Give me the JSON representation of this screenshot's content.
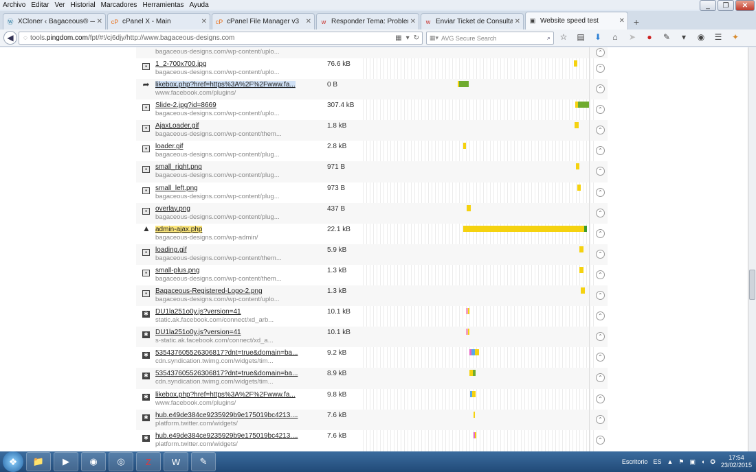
{
  "menu": [
    "Archivo",
    "Editar",
    "Ver",
    "Historial",
    "Marcadores",
    "Herramientas",
    "Ayuda"
  ],
  "tabs": [
    {
      "title": "XCloner ‹ Bagaceous® — Wor...",
      "icon": "wordpress-icon",
      "active": false
    },
    {
      "title": "cPanel X - Main",
      "icon": "cpanel-icon",
      "active": false
    },
    {
      "title": "cPanel File Manager v3",
      "icon": "cpanel-icon",
      "active": false
    },
    {
      "title": "Responder Tema: Problem...",
      "icon": "w-icon",
      "active": false
    },
    {
      "title": "Enviar Ticket de Consulta - ...",
      "icon": "w-icon",
      "active": false
    },
    {
      "title": "Website speed test",
      "icon": "pingdom-icon",
      "active": true
    }
  ],
  "url": {
    "prefix": "tools.",
    "domain": "pingdom.com",
    "rest": "/fpt/#!/cj6djy/http://www.bagaceous-designs.com"
  },
  "search_placeholder": "AVG Secure Search",
  "rows": [
    {
      "name": "",
      "path": "bagaceous-designs.com/wp-content/uplo...",
      "size": "",
      "icon": "image",
      "bars": []
    },
    {
      "name": "1_2-700x700.jpg",
      "path": "bagaceous-designs.com/wp-content/uplo...",
      "size": "76.6 kB",
      "icon": "image",
      "bars": [
        {
          "start": 0.908,
          "width": 0.017,
          "color": "#f5d20f"
        }
      ]
    },
    {
      "name": "likebox.php?href=https%3A%2F%2Fwww.fa...",
      "path": "www.facebook.com/plugins/",
      "size": "0 B",
      "icon": "redirect",
      "hl": "blue",
      "bars": [
        {
          "start": 0.415,
          "width": 0.006,
          "color": "#f5d20f"
        },
        {
          "start": 0.421,
          "width": 0.04,
          "color": "#6fab2f"
        }
      ]
    },
    {
      "name": "Slide-2.jpg?id=8669",
      "path": "bagaceous-designs.com/wp-content/uplo...",
      "size": "307.4 kB",
      "icon": "image",
      "bars": [
        {
          "start": 0.914,
          "width": 0.014,
          "color": "#f5d20f"
        },
        {
          "start": 0.928,
          "width": 0.047,
          "color": "#6fab2f"
        }
      ]
    },
    {
      "name": "AjaxLoader.gif",
      "path": "bagaceous-designs.com/wp-content/them...",
      "size": "1.8 kB",
      "icon": "image",
      "bars": [
        {
          "start": 0.913,
          "width": 0.017,
          "color": "#f5d20f"
        }
      ]
    },
    {
      "name": "loader.gif",
      "path": "bagaceous-designs.com/wp-content/plug...",
      "size": "2.8 kB",
      "icon": "image",
      "bars": [
        {
          "start": 0.438,
          "width": 0.012,
          "color": "#f5d20f"
        }
      ]
    },
    {
      "name": "small_right.png",
      "path": "bagaceous-designs.com/wp-content/plug...",
      "size": "971 B",
      "icon": "image",
      "bars": [
        {
          "start": 0.918,
          "width": 0.014,
          "color": "#f5d20f"
        }
      ]
    },
    {
      "name": "small_left.png",
      "path": "bagaceous-designs.com/wp-content/plug...",
      "size": "973 B",
      "icon": "image",
      "bars": [
        {
          "start": 0.924,
          "width": 0.015,
          "color": "#f5d20f"
        }
      ]
    },
    {
      "name": "overlay.png",
      "path": "bagaceous-designs.com/wp-content/plug...",
      "size": "437 B",
      "icon": "image",
      "bars": [
        {
          "start": 0.453,
          "width": 0.017,
          "color": "#f5d20f"
        }
      ]
    },
    {
      "name": "admin-ajax.php",
      "path": "bagaceous-designs.com/wp-admin/",
      "size": "22.1 kB",
      "icon": "warning",
      "hl": "yellow",
      "bars": [
        {
          "start": 0.44,
          "width": 0.512,
          "color": "#f5d20f"
        },
        {
          "start": 0.952,
          "width": 0.012,
          "color": "#3c9b2e"
        }
      ]
    },
    {
      "name": "loading.gif",
      "path": "bagaceous-designs.com/wp-content/them...",
      "size": "5.9 kB",
      "icon": "image",
      "bars": [
        {
          "start": 0.934,
          "width": 0.017,
          "color": "#f5d20f"
        }
      ]
    },
    {
      "name": "small-plus.png",
      "path": "bagaceous-designs.com/wp-content/them...",
      "size": "1.3 kB",
      "icon": "image",
      "bars": [
        {
          "start": 0.934,
          "width": 0.016,
          "color": "#f5d20f"
        }
      ]
    },
    {
      "name": "Bagaceous-Registered-Logo-2.png",
      "path": "bagaceous-designs.com/wp-content/uplo...",
      "size": "1.3 kB",
      "icon": "image",
      "bars": [
        {
          "start": 0.94,
          "width": 0.016,
          "color": "#f5d20f"
        }
      ]
    },
    {
      "name": "DU1la251o0y.js?version=41",
      "path": "static.ak.facebook.com/connect/xd_arb...",
      "size": "10.1 kB",
      "icon": "script",
      "bars": [
        {
          "start": 0.45,
          "width": 0.008,
          "color": "#f5a0c0"
        },
        {
          "start": 0.458,
          "width": 0.006,
          "color": "#f5d20f"
        }
      ]
    },
    {
      "name": "DU1la251o0y.js?version=41",
      "path": "s-static.ak.facebook.com/connect/xd_a...",
      "size": "10.1 kB",
      "icon": "script",
      "bars": [
        {
          "start": 0.45,
          "width": 0.008,
          "color": "#f5a0c0"
        },
        {
          "start": 0.458,
          "width": 0.006,
          "color": "#f5d20f"
        }
      ]
    },
    {
      "name": "535437605526306817?dnt=true&domain=ba...",
      "path": "cdn.syndication.twimg.com/widgets/tim...",
      "size": "9.2 kB",
      "icon": "script",
      "bars": [
        {
          "start": 0.465,
          "width": 0.008,
          "color": "#e864c8"
        },
        {
          "start": 0.473,
          "width": 0.014,
          "color": "#5aa9e6"
        },
        {
          "start": 0.487,
          "width": 0.018,
          "color": "#f5d20f"
        }
      ]
    },
    {
      "name": "535437605526306817?dnt=true&domain=ba...",
      "path": "cdn.syndication.twimg.com/widgets/tim...",
      "size": "8.9 kB",
      "icon": "script",
      "bars": [
        {
          "start": 0.465,
          "width": 0.015,
          "color": "#f5d20f"
        },
        {
          "start": 0.48,
          "width": 0.01,
          "color": "#6fab2f"
        }
      ]
    },
    {
      "name": "likebox.php?href=https%3A%2F%2Fwww.fa...",
      "path": "www.facebook.com/plugins/",
      "size": "9.8 kB",
      "icon": "script",
      "bars": [
        {
          "start": 0.468,
          "width": 0.01,
          "color": "#5aa9e6"
        },
        {
          "start": 0.478,
          "width": 0.014,
          "color": "#f5d20f"
        }
      ]
    },
    {
      "name": "hub.e49de384ce9235929b9e175019bc4213....",
      "path": "platform.twitter.com/widgets/",
      "size": "7.6 kB",
      "icon": "script",
      "bars": [
        {
          "start": 0.482,
          "width": 0.006,
          "color": "#f5d20f"
        }
      ]
    },
    {
      "name": "hub.e49de384ce9235929b9e175019bc4213....",
      "path": "platform.twitter.com/widgets/",
      "size": "7.6 kB",
      "icon": "script",
      "bars": [
        {
          "start": 0.482,
          "width": 0.005,
          "color": "#e864c8"
        },
        {
          "start": 0.487,
          "width": 0.006,
          "color": "#f5d20f"
        }
      ]
    }
  ],
  "taskbar": {
    "desktop_label": "Escritorio",
    "lang": "ES",
    "time": "17:54",
    "date": "23/02/2015"
  }
}
